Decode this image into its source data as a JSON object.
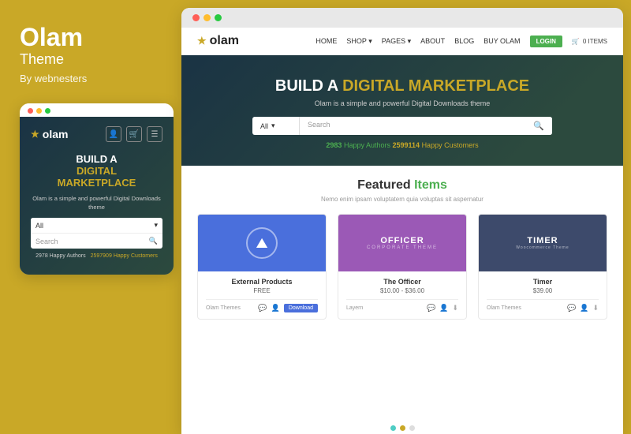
{
  "left": {
    "brand": "Olam",
    "theme_label": "Theme",
    "by": "By webnesters",
    "mobile": {
      "dots": [
        "red",
        "yellow",
        "green"
      ],
      "logo": "olam",
      "headline_build": "BUILD A",
      "headline_digital": "DIGITAL",
      "headline_marketplace": "MARKETPLACE",
      "sub": "Olam is a simple and powerful Digital Downloads theme",
      "search_cat": "All",
      "search_placeholder": "Search",
      "stat_authors_num": "2978",
      "stat_authors_label": "Happy Authors",
      "stat_customers_num": "2597909",
      "stat_customers_label": "Happy Customers"
    }
  },
  "right": {
    "browser_dots": [
      "red",
      "yellow",
      "green"
    ],
    "header": {
      "logo": "olam",
      "nav_items": [
        "HOME",
        "SHOP",
        "PAGES",
        "ABOUT",
        "BLOG",
        "BUY OLAM"
      ],
      "login_label": "LOGIN",
      "cart_label": "0 ITEMS"
    },
    "hero": {
      "title_white": "BUILD A",
      "title_yellow": "DIGITAL MARKETPLACE",
      "subtitle": "Olam is a simple and powerful Digital Downloads theme",
      "search_cat": "All",
      "search_placeholder": "Search",
      "stat_authors_num": "2983",
      "stat_authors_label": "Happy Authors",
      "stat_customers_num": "2599114",
      "stat_customers_label": "Happy Customers"
    },
    "featured": {
      "title_black": "Featured",
      "title_green": "Items",
      "desc": "Nemo enim ipsam voluptatem quia voluptas sit aspernatur",
      "products": [
        {
          "name": "External Products",
          "price": "FREE",
          "author": "Olam Themes",
          "thumb_type": "blue",
          "action": "Download"
        },
        {
          "name": "The Officer",
          "price": "$10.00 - $36.00",
          "author": "Layern",
          "thumb_type": "purple",
          "action": ""
        },
        {
          "name": "Timer",
          "price": "$39.00",
          "author": "Olam Themes",
          "thumb_type": "dark",
          "action": ""
        }
      ]
    },
    "pagination_dots": [
      "teal",
      "yellow",
      "gray"
    ]
  }
}
